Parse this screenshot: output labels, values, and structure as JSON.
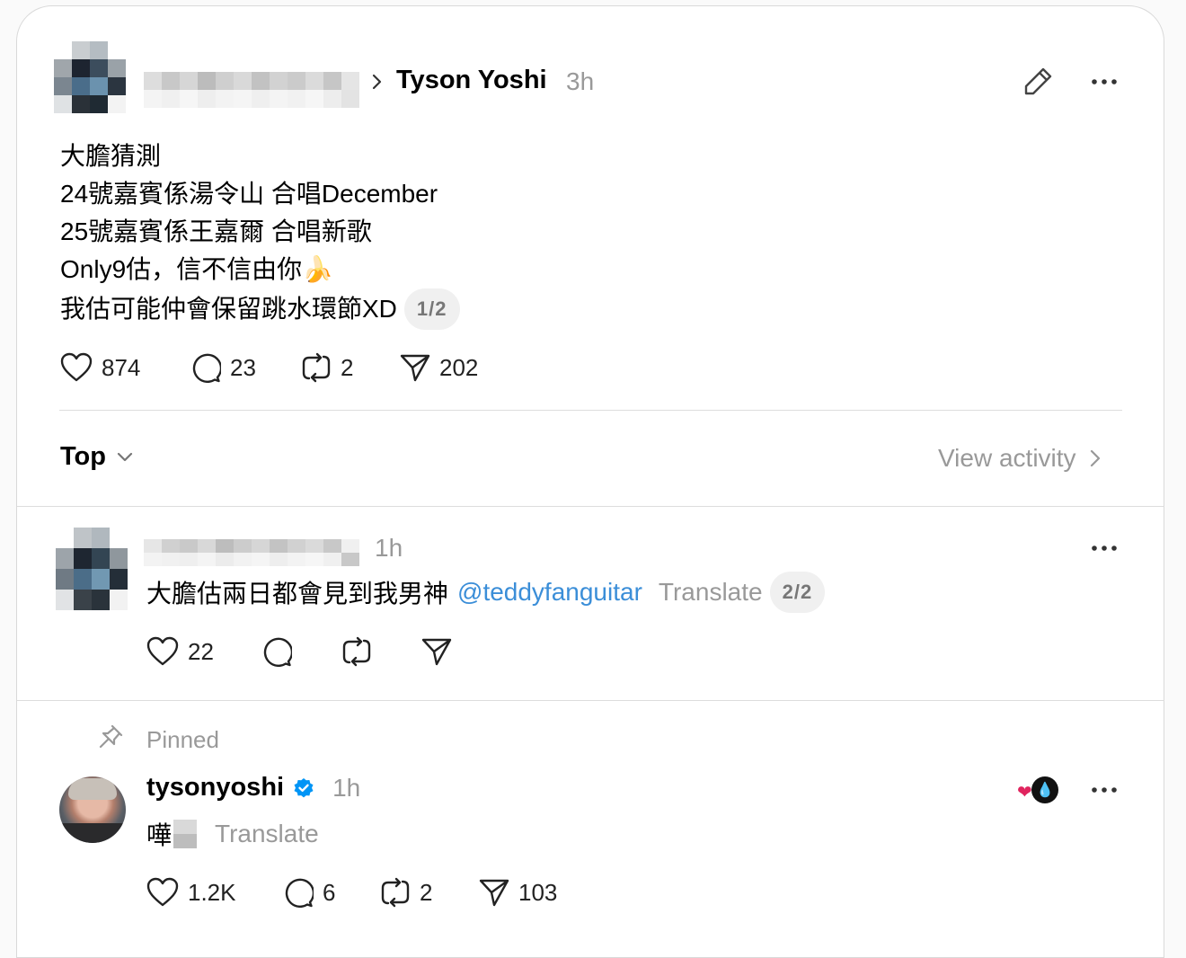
{
  "post": {
    "author": "Tyson Yoshi",
    "time": "3h",
    "lines": [
      "大膽猜測",
      "24號嘉賓係湯令山 合唱December",
      "25號嘉賓係王嘉爾 合唱新歌",
      "Only9估，信不信由你🍌",
      "我估可能仲會保留跳水環節XD"
    ],
    "page_indicator": "1/2",
    "stats": {
      "likes": "874",
      "comments": "23",
      "reposts": "2",
      "shares": "202"
    },
    "icons": [
      "pencil-icon",
      "more-icon",
      "heart-icon",
      "comment-icon",
      "repost-icon",
      "share-icon",
      "chevron-right-icon"
    ]
  },
  "sort": {
    "label": "Top",
    "view_activity": "View activity"
  },
  "reply1": {
    "time": "1h",
    "text": "大膽估兩日都會見到我男神",
    "mention": "@teddyfanguitar",
    "translate": "Translate",
    "page_indicator": "2/2",
    "stats": {
      "likes": "22"
    },
    "colors": {
      "mention": "#3b8ed8"
    }
  },
  "reply2": {
    "pinned_label": "Pinned",
    "username": "tysonyoshi",
    "time": "1h",
    "text": "嘩",
    "translate": "Translate",
    "reactions": [
      "❤",
      "💧"
    ],
    "stats": {
      "likes": "1.2K",
      "comments": "6",
      "reposts": "2",
      "shares": "103"
    },
    "icons": [
      "pin-icon",
      "verified-icon",
      "avatar"
    ],
    "colors": {
      "verified": "#0095f6"
    }
  }
}
